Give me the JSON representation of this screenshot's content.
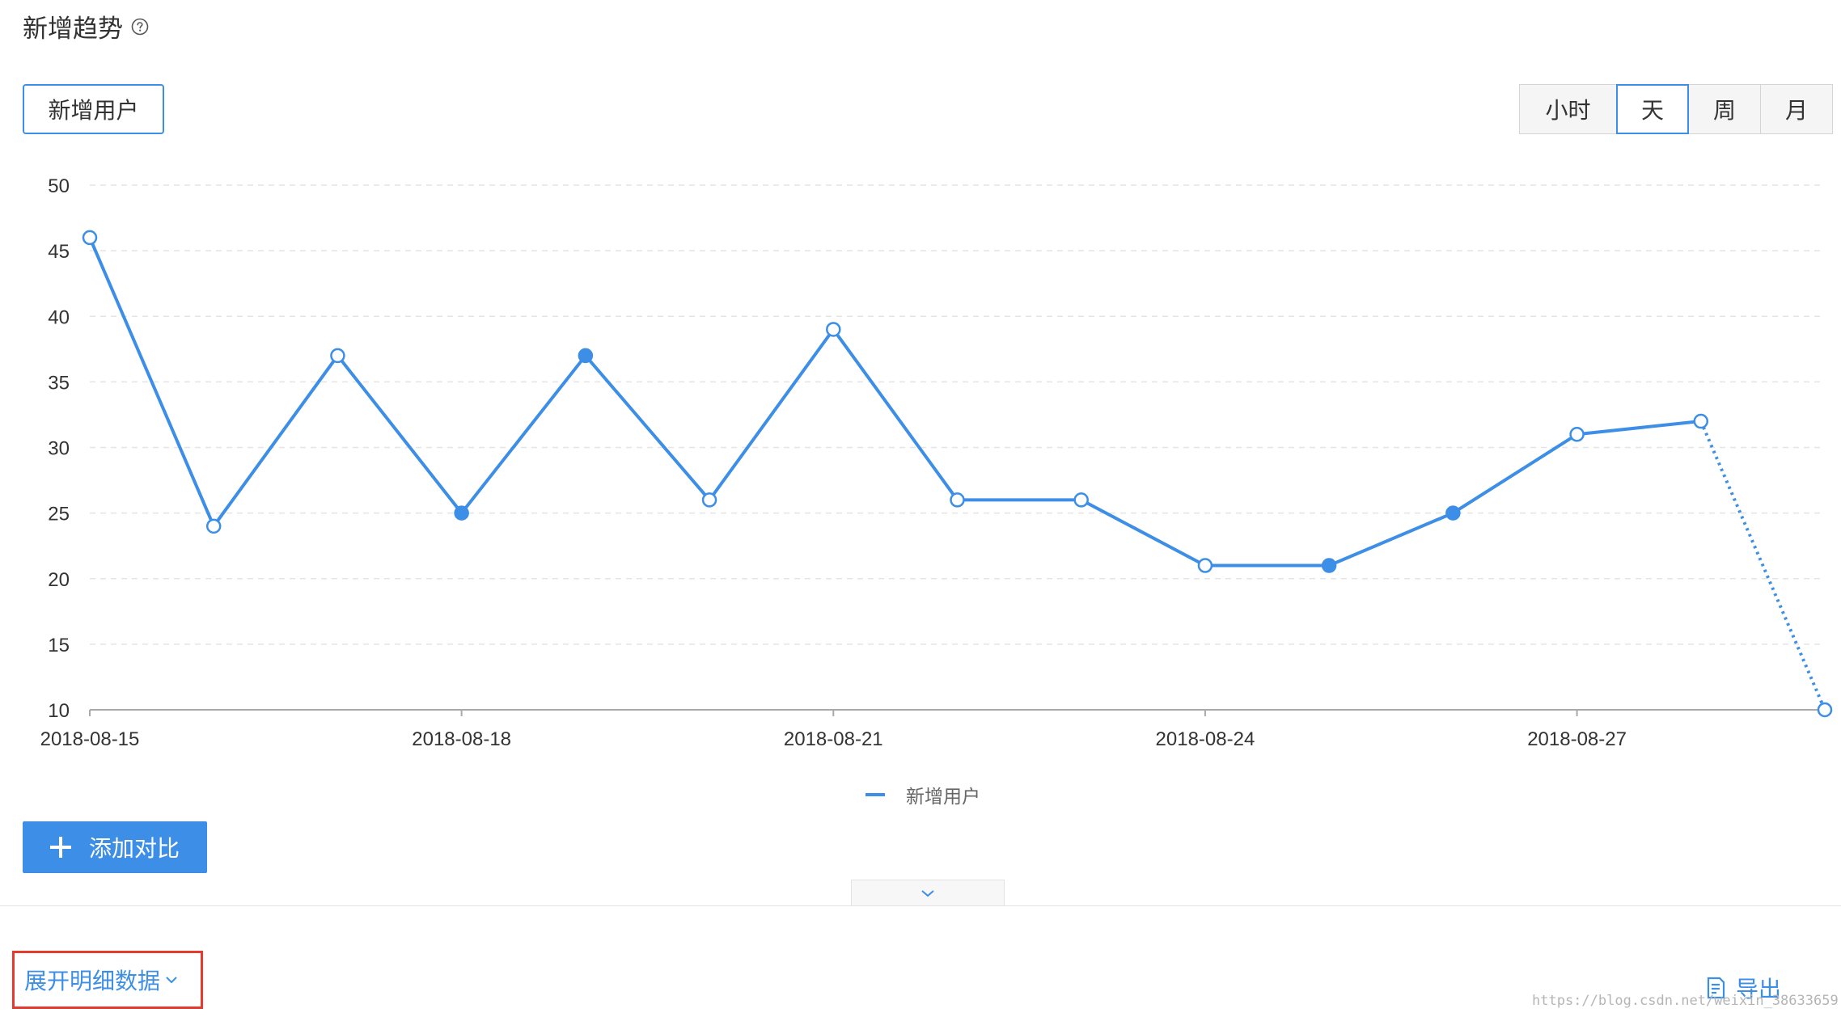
{
  "header": {
    "title": "新增趋势",
    "help_icon": "question-circle-icon"
  },
  "metric_selector": {
    "label": "新增用户"
  },
  "granularity": {
    "options": [
      "小时",
      "天",
      "周",
      "月"
    ],
    "selected": "天"
  },
  "chart_data": {
    "type": "line",
    "title": "",
    "xlabel": "",
    "ylabel": "",
    "x": [
      "2018-08-15",
      "2018-08-16",
      "2018-08-17",
      "2018-08-18",
      "2018-08-19",
      "2018-08-20",
      "2018-08-21",
      "2018-08-22",
      "2018-08-23",
      "2018-08-24",
      "2018-08-25",
      "2018-08-26",
      "2018-08-27",
      "2018-08-28",
      "2018-08-29"
    ],
    "x_tick_labels": [
      "2018-08-15",
      "2018-08-18",
      "2018-08-21",
      "2018-08-24",
      "2018-08-27"
    ],
    "y_ticks": [
      10,
      15,
      20,
      25,
      30,
      35,
      40,
      45,
      50
    ],
    "ylim": [
      10,
      50
    ],
    "series": [
      {
        "name": "新增用户",
        "color": "#3d8ee6",
        "values": [
          46,
          24,
          37,
          25,
          37,
          26,
          39,
          26,
          26,
          21,
          21,
          25,
          31,
          32,
          10
        ],
        "filled_points": [
          false,
          false,
          false,
          true,
          true,
          false,
          false,
          false,
          false,
          false,
          true,
          true,
          false,
          false,
          false
        ],
        "last_segment_dotted": true
      }
    ],
    "grid": "horizontal dashed",
    "legend_position": "bottom-center"
  },
  "legend": {
    "label": "新增用户"
  },
  "actions": {
    "add_compare": "添加对比",
    "collapse_icon": "chevron-down-icon",
    "expand_detail": "展开明细数据",
    "export": "导出"
  },
  "watermark": "https://blog.csdn.net/weixin_38633659"
}
